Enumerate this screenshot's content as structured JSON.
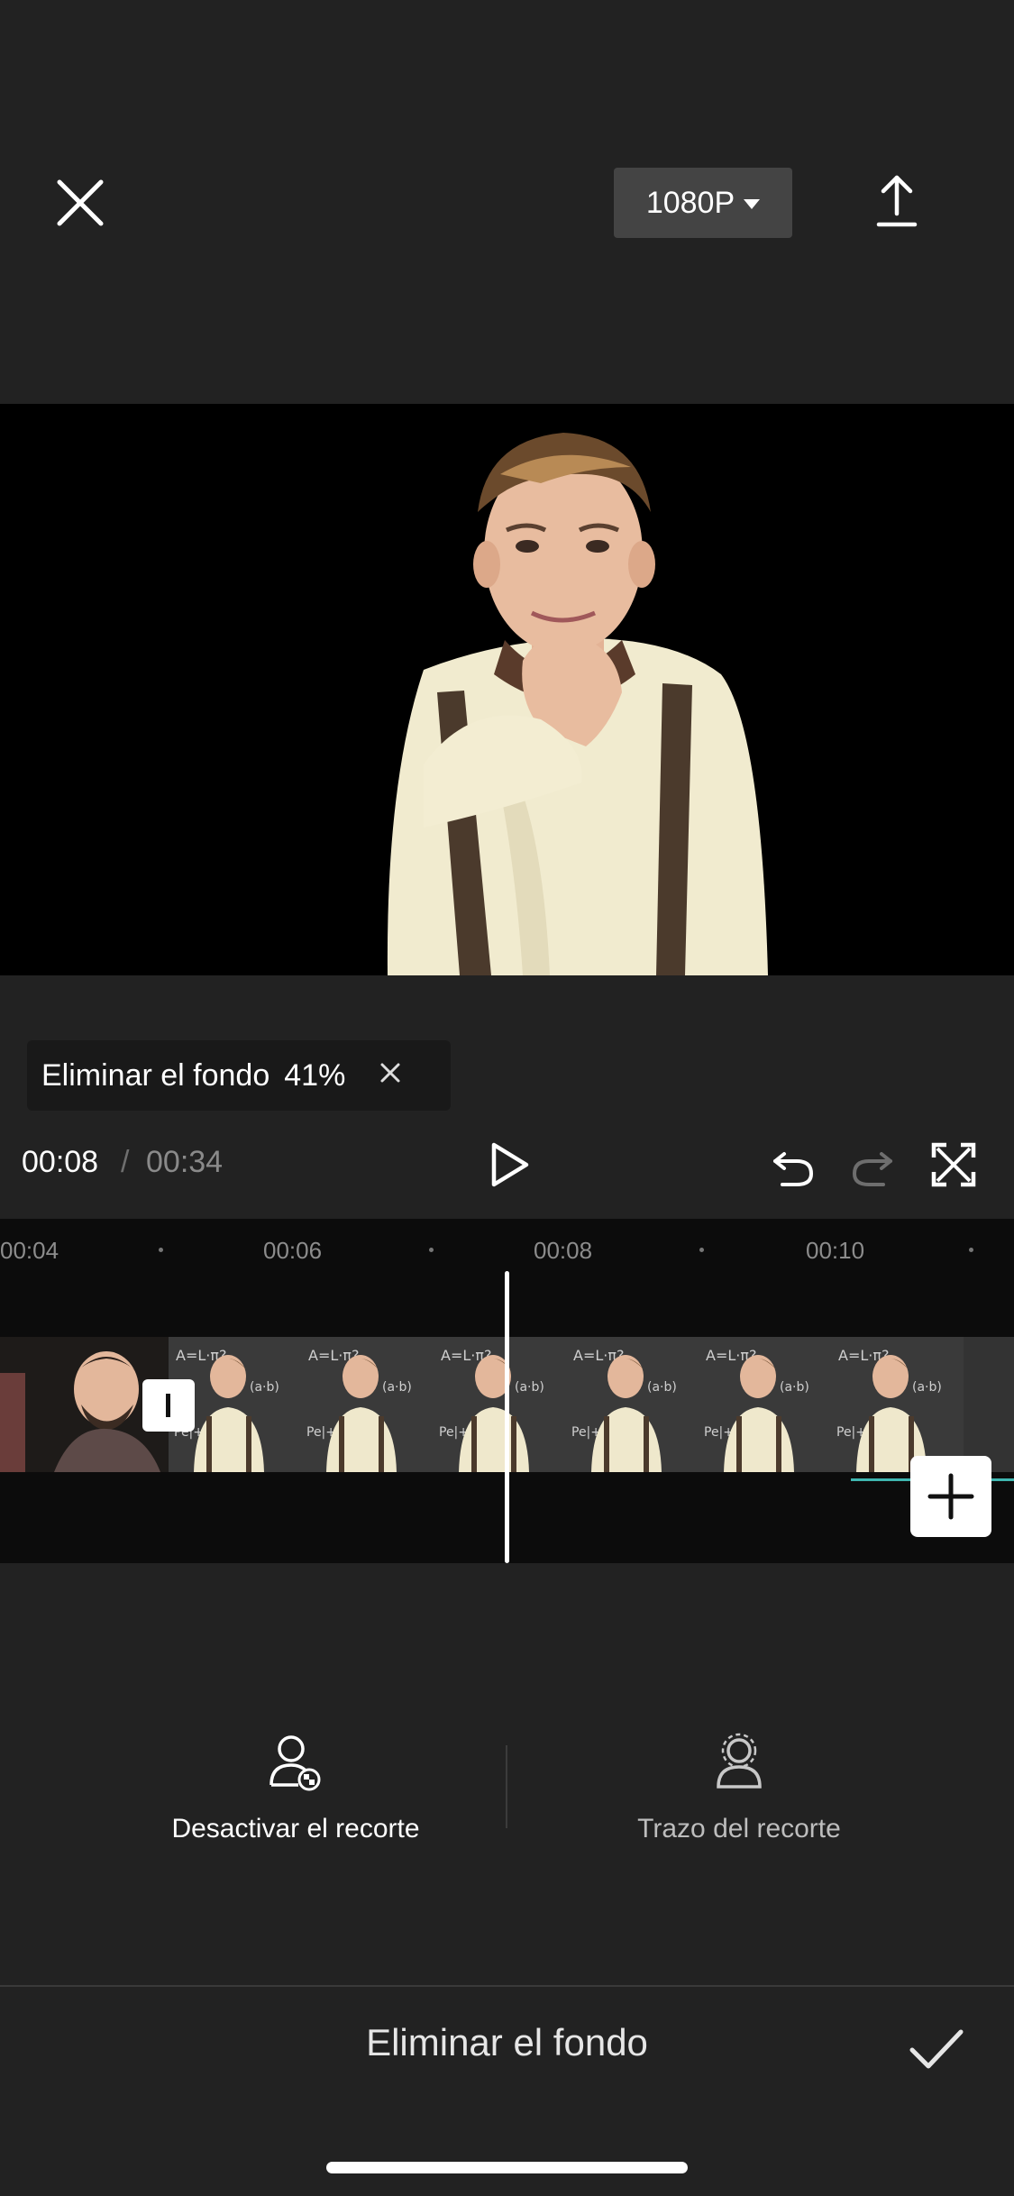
{
  "header": {
    "close_icon": "close-icon",
    "resolution_label": "1080P",
    "export_icon": "upload-icon"
  },
  "progress": {
    "label": "Eliminar el fondo",
    "percent_text": "41%",
    "percent": 41
  },
  "playback": {
    "current_time": "00:08",
    "separator": "/",
    "total_time": "00:34"
  },
  "timeline": {
    "ticks": [
      "00:04",
      "00:06",
      "00:08",
      "00:10"
    ]
  },
  "options": {
    "disable_label": "Desactivar el recorte",
    "stroke_label": "Trazo del recorte"
  },
  "footer": {
    "title": "Eliminar el fondo"
  },
  "colors": {
    "background": "#222222",
    "accent_teal": "#3fb6b0"
  }
}
